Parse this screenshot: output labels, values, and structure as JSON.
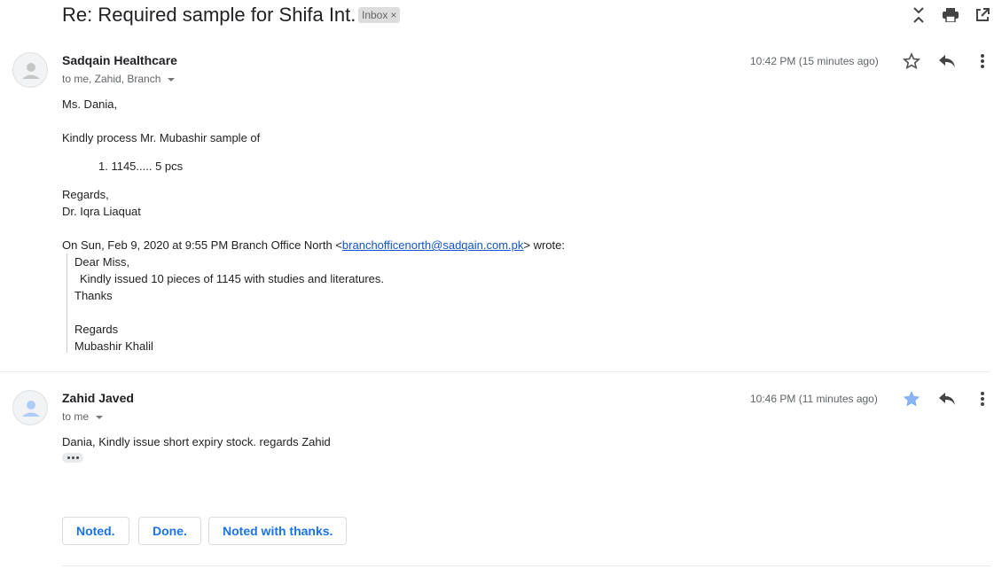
{
  "thread": {
    "subject": "Re: Required sample for Shifa Int.",
    "label": "Inbox",
    "label_close": "×"
  },
  "toolbar_icons": [
    "collapse-all-icon",
    "print-icon",
    "open-in-new-window-icon"
  ],
  "messages": [
    {
      "sender": "Sadqain Healthcare",
      "recipients": "to me, Zahid, Branch",
      "time": "10:42 PM (15 minutes ago)",
      "starred": false,
      "body": {
        "greeting": "Ms. Dania,",
        "line1": "Kindly process Mr. Mubashir sample of",
        "list_item": "1. 1145..... 5 pcs",
        "regards": "Regards,",
        "signature": "Dr. Iqra Liaquat",
        "quote_header_pre": "On Sun, Feb 9, 2020 at 9:55 PM Branch Office North <",
        "quote_header_email": "branchofficenorth@sadqain.com.pk",
        "quote_header_post": "> wrote:",
        "quoted": {
          "line1": "Dear Miss,",
          "line2": "Kindly issued 10 pieces of 1145 with studies and literatures.",
          "line3": "Thanks",
          "line4": "Regards",
          "line5": "Mubashir Khalil"
        }
      }
    },
    {
      "sender": "Zahid Javed",
      "recipients": "to me",
      "time": "10:46 PM (11 minutes ago)",
      "starred": true,
      "body": {
        "line1": "Dania, Kindly issue short expiry stock. regards Zahid"
      }
    }
  ],
  "smart_replies": [
    "Noted.",
    "Done.",
    "Noted with thanks."
  ],
  "colors": {
    "accent": "#1a73e8",
    "star_active": "#8ab4f8",
    "link": "#1155cc"
  }
}
